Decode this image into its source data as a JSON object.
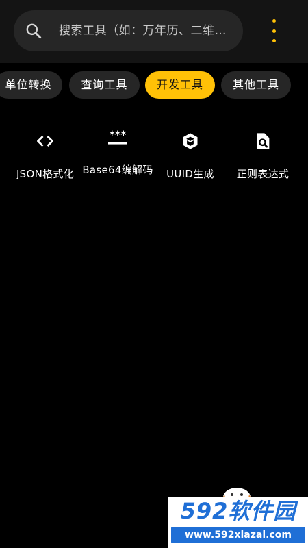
{
  "search": {
    "placeholder": "搜索工具（如：万年历、二维…"
  },
  "tabs": [
    {
      "label": "单位转换",
      "active": false
    },
    {
      "label": "查询工具",
      "active": false
    },
    {
      "label": "开发工具",
      "active": true
    },
    {
      "label": "其他工具",
      "active": false
    }
  ],
  "tools": [
    {
      "label": "JSON格式化",
      "icon": "code-brackets-icon"
    },
    {
      "label": "Base64编解码",
      "icon": "password-icon"
    },
    {
      "label": "UUID生成",
      "icon": "cube-icon"
    },
    {
      "label": "正则表达式",
      "icon": "file-search-icon"
    }
  ],
  "watermark": {
    "brand": "592软件园",
    "url": "www.592xiazai.com"
  },
  "colors": {
    "accent": "#ffc107",
    "background": "#000000",
    "surface": "#262626"
  }
}
